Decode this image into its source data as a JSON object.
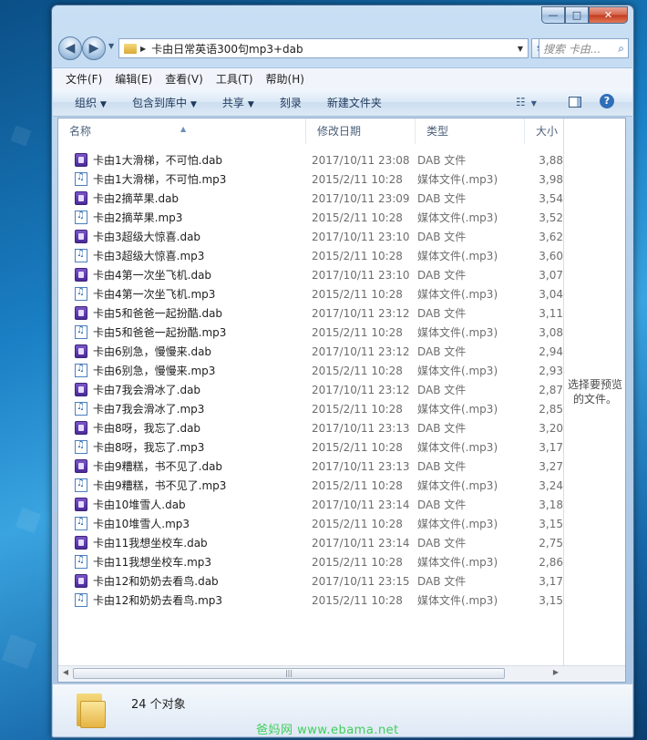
{
  "window": {
    "minimize_glyph": "—",
    "maximize_glyph": "□",
    "close_glyph": "✕"
  },
  "address": {
    "path": "卡由日常英语300句mp3+dab",
    "search_placeholder": "搜索 卡由..."
  },
  "menu": [
    "文件(F)",
    "编辑(E)",
    "查看(V)",
    "工具(T)",
    "帮助(H)"
  ],
  "toolbar": {
    "organize": "组织",
    "include_library": "包含到库中",
    "share": "共享",
    "burn": "刻录",
    "new_folder": "新建文件夹"
  },
  "columns": {
    "name": "名称",
    "date": "修改日期",
    "type": "类型",
    "size": "大小"
  },
  "files": [
    {
      "name": "卡由1大滑梯，不可怕.dab",
      "date": "2017/10/11 23:08",
      "type": "DAB 文件",
      "size": "3,88",
      "kind": "dab"
    },
    {
      "name": "卡由1大滑梯，不可怕.mp3",
      "date": "2015/2/11 10:28",
      "type": "媒体文件(.mp3)",
      "size": "3,98",
      "kind": "mp3"
    },
    {
      "name": "卡由2摘苹果.dab",
      "date": "2017/10/11 23:09",
      "type": "DAB 文件",
      "size": "3,54",
      "kind": "dab"
    },
    {
      "name": "卡由2摘苹果.mp3",
      "date": "2015/2/11 10:28",
      "type": "媒体文件(.mp3)",
      "size": "3,52",
      "kind": "mp3"
    },
    {
      "name": "卡由3超级大惊喜.dab",
      "date": "2017/10/11 23:10",
      "type": "DAB 文件",
      "size": "3,62",
      "kind": "dab"
    },
    {
      "name": "卡由3超级大惊喜.mp3",
      "date": "2015/2/11 10:28",
      "type": "媒体文件(.mp3)",
      "size": "3,60",
      "kind": "mp3"
    },
    {
      "name": "卡由4第一次坐飞机.dab",
      "date": "2017/10/11 23:10",
      "type": "DAB 文件",
      "size": "3,07",
      "kind": "dab"
    },
    {
      "name": "卡由4第一次坐飞机.mp3",
      "date": "2015/2/11 10:28",
      "type": "媒体文件(.mp3)",
      "size": "3,04",
      "kind": "mp3"
    },
    {
      "name": "卡由5和爸爸一起扮酷.dab",
      "date": "2017/10/11 23:12",
      "type": "DAB 文件",
      "size": "3,11",
      "kind": "dab"
    },
    {
      "name": "卡由5和爸爸一起扮酷.mp3",
      "date": "2015/2/11 10:28",
      "type": "媒体文件(.mp3)",
      "size": "3,08",
      "kind": "mp3"
    },
    {
      "name": "卡由6别急，慢慢来.dab",
      "date": "2017/10/11 23:12",
      "type": "DAB 文件",
      "size": "2,94",
      "kind": "dab"
    },
    {
      "name": "卡由6别急，慢慢来.mp3",
      "date": "2015/2/11 10:28",
      "type": "媒体文件(.mp3)",
      "size": "2,93",
      "kind": "mp3"
    },
    {
      "name": "卡由7我会滑冰了.dab",
      "date": "2017/10/11 23:12",
      "type": "DAB 文件",
      "size": "2,87",
      "kind": "dab"
    },
    {
      "name": "卡由7我会滑冰了.mp3",
      "date": "2015/2/11 10:28",
      "type": "媒体文件(.mp3)",
      "size": "2,85",
      "kind": "mp3"
    },
    {
      "name": "卡由8呀，我忘了.dab",
      "date": "2017/10/11 23:13",
      "type": "DAB 文件",
      "size": "3,20",
      "kind": "dab"
    },
    {
      "name": "卡由8呀，我忘了.mp3",
      "date": "2015/2/11 10:28",
      "type": "媒体文件(.mp3)",
      "size": "3,17",
      "kind": "mp3"
    },
    {
      "name": "卡由9糟糕，书不见了.dab",
      "date": "2017/10/11 23:13",
      "type": "DAB 文件",
      "size": "3,27",
      "kind": "dab"
    },
    {
      "name": "卡由9糟糕，书不见了.mp3",
      "date": "2015/2/11 10:28",
      "type": "媒体文件(.mp3)",
      "size": "3,24",
      "kind": "mp3"
    },
    {
      "name": "卡由10堆雪人.dab",
      "date": "2017/10/11 23:14",
      "type": "DAB 文件",
      "size": "3,18",
      "kind": "dab"
    },
    {
      "name": "卡由10堆雪人.mp3",
      "date": "2015/2/11 10:28",
      "type": "媒体文件(.mp3)",
      "size": "3,15",
      "kind": "mp3"
    },
    {
      "name": "卡由11我想坐校车.dab",
      "date": "2017/10/11 23:14",
      "type": "DAB 文件",
      "size": "2,75",
      "kind": "dab"
    },
    {
      "name": "卡由11我想坐校车.mp3",
      "date": "2015/2/11 10:28",
      "type": "媒体文件(.mp3)",
      "size": "2,86",
      "kind": "mp3"
    },
    {
      "name": "卡由12和奶奶去看鸟.dab",
      "date": "2017/10/11 23:15",
      "type": "DAB 文件",
      "size": "3,17",
      "kind": "dab"
    },
    {
      "name": "卡由12和奶奶去看鸟.mp3",
      "date": "2015/2/11 10:28",
      "type": "媒体文件(.mp3)",
      "size": "3,15",
      "kind": "mp3"
    }
  ],
  "preview_text": "选择要预览的文件。",
  "status": {
    "count": "24 个对象"
  },
  "watermark": "爸妈网  www.ebama.net"
}
